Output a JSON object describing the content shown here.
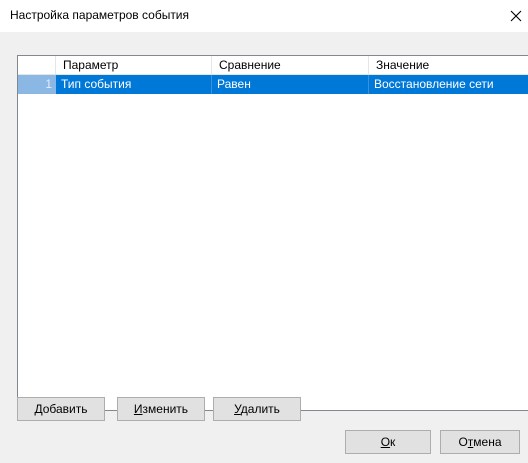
{
  "window": {
    "title": "Настройка параметров события"
  },
  "grid": {
    "columns": [
      "Параметр",
      "Сравнение",
      "Значение"
    ],
    "rows": [
      {
        "num": "1",
        "param": "Тип события",
        "compare": "Равен",
        "value": "Восстановление сети",
        "selected": true
      }
    ]
  },
  "buttons": {
    "add": {
      "u": "Д",
      "rest": "обавить"
    },
    "edit": {
      "u": "И",
      "rest": "зменить"
    },
    "delete": {
      "u": "У",
      "rest": "далить"
    },
    "ok": {
      "u": "О",
      "rest": "к"
    },
    "cancel": {
      "pre": "О",
      "u": "т",
      "rest": "мена"
    }
  },
  "colors": {
    "selection": "#0078d7",
    "rownum_bg": "#8ab7e3"
  }
}
